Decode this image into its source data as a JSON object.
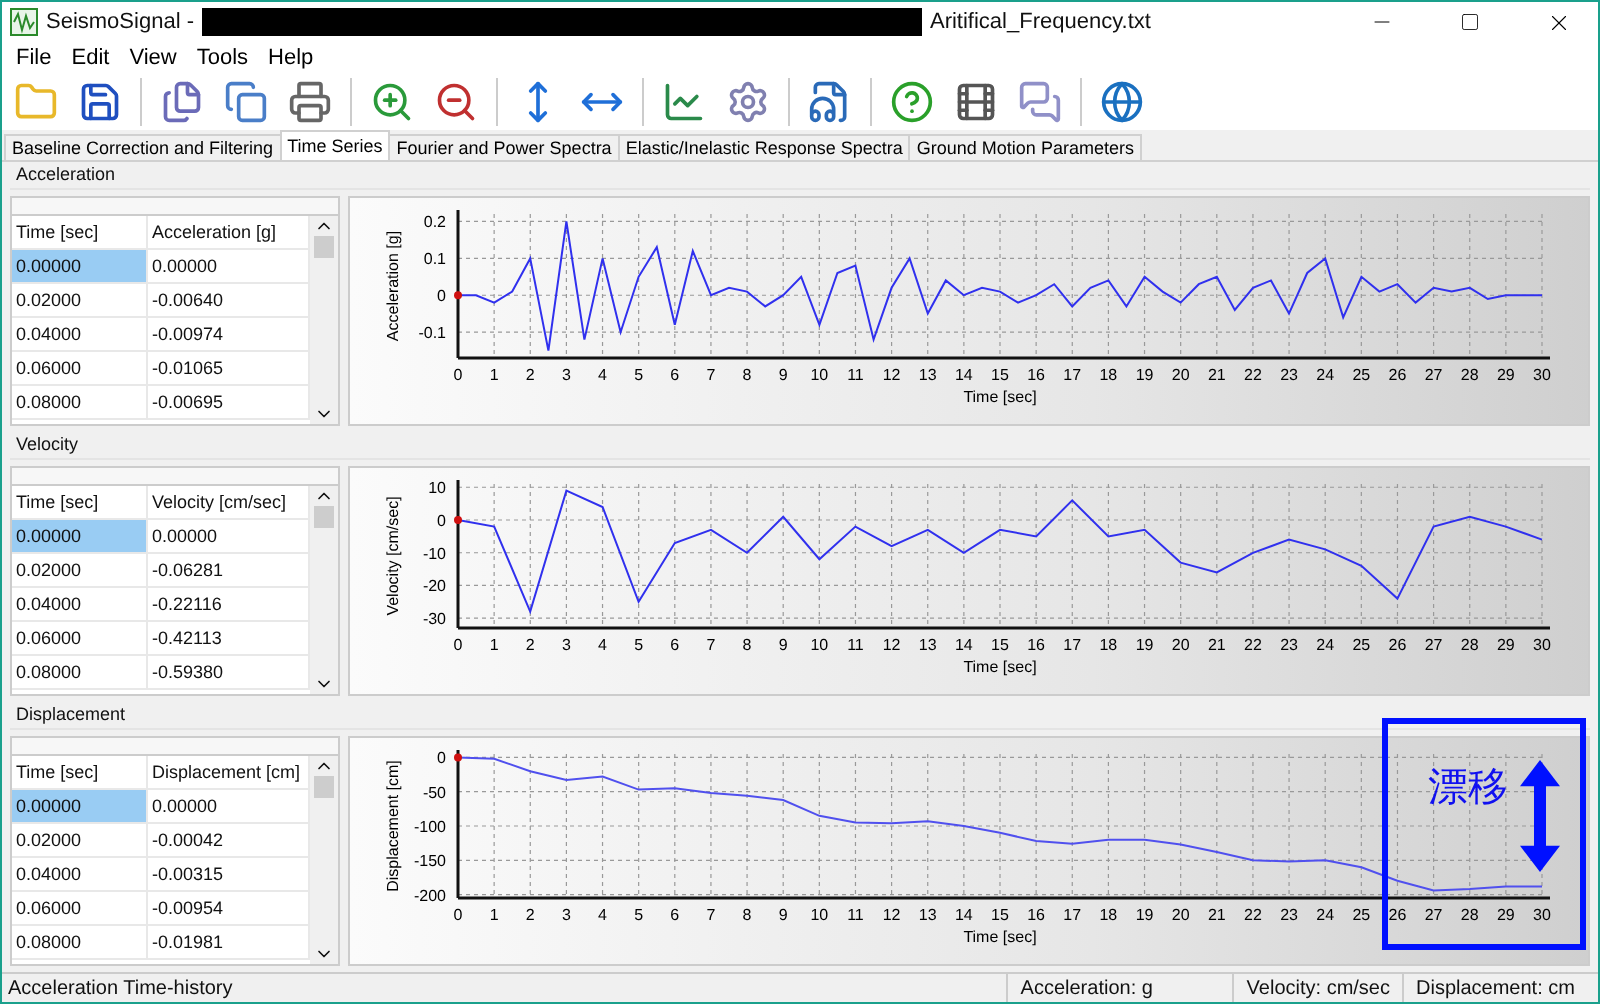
{
  "window": {
    "title_prefix": "SeismoSignal -",
    "title_redacted": true,
    "title_suffix": "Aritifical_Frequency.txt"
  },
  "menu": [
    "File",
    "Edit",
    "View",
    "Tools",
    "Help"
  ],
  "tabs": [
    {
      "label": "Baseline Correction and Filtering",
      "selected": false
    },
    {
      "label": "Time Series",
      "selected": true
    },
    {
      "label": "Fourier and Power Spectra",
      "selected": false
    },
    {
      "label": "Elastic/Inelastic Response Spectra",
      "selected": false
    },
    {
      "label": "Ground Motion Parameters",
      "selected": false
    }
  ],
  "sections": [
    {
      "title": "Acceleration",
      "columns": [
        "Time [sec]",
        "Acceleration [g]"
      ],
      "rows": [
        {
          "cells": [
            "0.00000",
            "0.00000"
          ],
          "selected": true
        },
        {
          "cells": [
            "0.02000",
            "-0.00640"
          ],
          "selected": false
        },
        {
          "cells": [
            "0.04000",
            "-0.00974"
          ],
          "selected": false
        },
        {
          "cells": [
            "0.06000",
            "-0.01065"
          ],
          "selected": false
        },
        {
          "cells": [
            "0.08000",
            "-0.00695"
          ],
          "selected": false
        }
      ],
      "chart_data": {
        "type": "line",
        "xlabel": "Time [sec]",
        "ylabel": "Acceleration [g]",
        "xlim": [
          0,
          30
        ],
        "ylim": [
          -0.17,
          0.22
        ],
        "xticks": [
          0,
          1,
          2,
          3,
          4,
          5,
          6,
          7,
          8,
          9,
          10,
          11,
          12,
          13,
          14,
          15,
          16,
          17,
          18,
          19,
          20,
          21,
          22,
          23,
          24,
          25,
          26,
          27,
          28,
          29,
          30
        ],
        "yticks": [
          {
            "value": -0.1,
            "label": "-0.1"
          },
          {
            "value": 0,
            "label": "0"
          },
          {
            "value": 0.1,
            "label": "0.1"
          },
          {
            "value": 0.2,
            "label": "0.2"
          }
        ],
        "x": [
          0,
          0.5,
          1,
          1.5,
          2,
          2.5,
          3,
          3.5,
          4,
          4.5,
          5,
          5.5,
          6,
          6.5,
          7,
          7.5,
          8,
          8.5,
          9,
          9.5,
          10,
          10.5,
          11,
          11.5,
          12,
          12.5,
          13,
          13.5,
          14,
          14.5,
          15,
          15.5,
          16,
          16.5,
          17,
          17.5,
          18,
          18.5,
          19,
          19.5,
          20,
          20.5,
          21,
          21.5,
          22,
          22.5,
          23,
          23.5,
          24,
          24.5,
          25,
          25.5,
          26,
          26.5,
          27,
          27.5,
          28,
          28.5,
          29,
          29.5,
          30
        ],
        "grid": true,
        "series": [
          {
            "color": "#3030ee",
            "values": [
              0,
              0,
              -0.02,
              0.01,
              0.1,
              -0.15,
              0.2,
              -0.12,
              0.1,
              -0.1,
              0.05,
              0.13,
              -0.08,
              0.12,
              0,
              0.02,
              0.01,
              -0.03,
              0,
              0.05,
              -0.08,
              0.06,
              0.08,
              -0.12,
              0.02,
              0.1,
              -0.05,
              0.04,
              0,
              0.02,
              0.01,
              -0.02,
              0,
              0.03,
              -0.03,
              0.02,
              0.04,
              -0.03,
              0.05,
              0.01,
              -0.02,
              0.03,
              0.05,
              -0.04,
              0.02,
              0.04,
              -0.05,
              0.06,
              0.1,
              -0.06,
              0.05,
              0.01,
              0.03,
              -0.02,
              0.02,
              0.01,
              0.02,
              -0.01,
              0,
              0,
              0
            ]
          }
        ]
      }
    },
    {
      "title": "Velocity",
      "columns": [
        "Time [sec]",
        "Velocity [cm/sec]"
      ],
      "rows": [
        {
          "cells": [
            "0.00000",
            "0.00000"
          ],
          "selected": true
        },
        {
          "cells": [
            "0.02000",
            "-0.06281"
          ],
          "selected": false
        },
        {
          "cells": [
            "0.04000",
            "-0.22116"
          ],
          "selected": false
        },
        {
          "cells": [
            "0.06000",
            "-0.42113"
          ],
          "selected": false
        },
        {
          "cells": [
            "0.08000",
            "-0.59380"
          ],
          "selected": false
        }
      ],
      "chart_data": {
        "type": "line",
        "xlabel": "Time [sec]",
        "ylabel": "Velocity [cm/sec]",
        "xlim": [
          0,
          30
        ],
        "ylim": [
          -33,
          11
        ],
        "xticks": [
          0,
          1,
          2,
          3,
          4,
          5,
          6,
          7,
          8,
          9,
          10,
          11,
          12,
          13,
          14,
          15,
          16,
          17,
          18,
          19,
          20,
          21,
          22,
          23,
          24,
          25,
          26,
          27,
          28,
          29,
          30
        ],
        "yticks": [
          -30,
          -20,
          -10,
          0,
          10
        ],
        "x": [
          0,
          1,
          2,
          3,
          4,
          5,
          6,
          7,
          8,
          9,
          10,
          11,
          12,
          13,
          14,
          15,
          16,
          17,
          18,
          19,
          20,
          21,
          22,
          23,
          24,
          25,
          26,
          27,
          28,
          29,
          30
        ],
        "grid": true,
        "series": [
          {
            "color": "#3030ee",
            "values": [
              0,
              -2,
              -28,
              9,
              4,
              -25,
              -7,
              -3,
              -10,
              1,
              -12,
              -2,
              -8,
              -3,
              -10,
              -3,
              -5,
              6,
              -5,
              -3,
              -13,
              -16,
              -10,
              -6,
              -9,
              -14,
              -24,
              -2,
              1,
              -2,
              -6
            ]
          }
        ]
      }
    },
    {
      "title": "Displacement",
      "columns": [
        "Time [sec]",
        "Displacement [cm]"
      ],
      "rows": [
        {
          "cells": [
            "0.00000",
            "0.00000"
          ],
          "selected": true
        },
        {
          "cells": [
            "0.02000",
            "-0.00042"
          ],
          "selected": false
        },
        {
          "cells": [
            "0.04000",
            "-0.00315"
          ],
          "selected": false
        },
        {
          "cells": [
            "0.06000",
            "-0.00954"
          ],
          "selected": false
        },
        {
          "cells": [
            "0.08000",
            "-0.01981"
          ],
          "selected": false
        }
      ],
      "chart_data": {
        "type": "line",
        "xlabel": "Time [sec]",
        "ylabel": "Displacement [cm]",
        "xlim": [
          0,
          30
        ],
        "ylim": [
          -205,
          5
        ],
        "xticks": [
          0,
          1,
          2,
          3,
          4,
          5,
          6,
          7,
          8,
          9,
          10,
          11,
          12,
          13,
          14,
          15,
          16,
          17,
          18,
          19,
          20,
          21,
          22,
          23,
          24,
          25,
          26,
          27,
          28,
          29,
          30
        ],
        "yticks": [
          -200,
          -150,
          -100,
          -50,
          0
        ],
        "x": [
          0,
          1,
          2,
          3,
          4,
          5,
          6,
          7,
          8,
          9,
          10,
          11,
          12,
          13,
          14,
          15,
          16,
          17,
          18,
          19,
          20,
          21,
          22,
          23,
          24,
          25,
          26,
          27,
          28,
          29,
          30
        ],
        "grid": true,
        "series": [
          {
            "color": "#5050ee",
            "values": [
              0,
              -2,
              -20,
              -33,
              -28,
              -47,
              -45,
              -52,
              -56,
              -62,
              -85,
              -95,
              -96,
              -93,
              -100,
              -110,
              -122,
              -126,
              -120,
              -120,
              -127,
              -138,
              -150,
              -152,
              -150,
              -160,
              -180,
              -194,
              -192,
              -188,
              -188
            ]
          }
        ]
      },
      "annotation": {
        "text": "漂移"
      }
    }
  ],
  "status_bar": {
    "left": "Acceleration Time-history",
    "cells": [
      "Acceleration: g",
      "Velocity: cm/sec",
      "Displacement: cm"
    ]
  }
}
